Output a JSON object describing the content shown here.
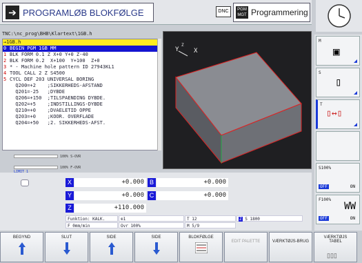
{
  "header": {
    "mode_left": "PROGRAMLØB BLOKFØLGE",
    "dnc": "DNC",
    "pgm_icon": "PGM MGT",
    "mode_right": "Programmering"
  },
  "path": "TNC:\\nc_prog\\BHB\\Klartext\\1GB.h",
  "program": {
    "file_tab": "→1GB.h",
    "lines": [
      {
        "n": "0",
        "t": "BEGIN PGM 1GB MM",
        "sel": true
      },
      {
        "n": "1",
        "t": "BLK FORM 0.1 Z X+0 Y+0 Z-40"
      },
      {
        "n": "2",
        "t": "BLK FORM 0.2  X+100  Y+100  Z+0"
      },
      {
        "n": "3",
        "t": "* - Machine hole pattern ID 27943KL1"
      },
      {
        "n": "4",
        "t": "TOOL CALL 2 Z S4500"
      },
      {
        "n": "5",
        "t": "CYCL DEF 203 UNIVERSAL BORING"
      },
      {
        "n": "",
        "t": "  Q200=+2    ;SIKKERHEDS-AFSTAND"
      },
      {
        "n": "",
        "t": "  Q201=-25   ;DYBDE"
      },
      {
        "n": "",
        "t": "  Q206=+150  ;TILSPAENDING DYBDE."
      },
      {
        "n": "",
        "t": "  Q202=+5    ;INDSTILLINGS-DYBDE"
      },
      {
        "n": "",
        "t": "  Q210=+0    ;DVAELETID OPPE"
      },
      {
        "n": "",
        "t": "  Q203=+0    ;KOOR. OVERFLADE"
      },
      {
        "n": "",
        "t": "  Q204=+50   ;2. SIKKERHEDS-AFST."
      }
    ]
  },
  "overrides": {
    "s": "100% S-OVR",
    "f": "100% F-OVR",
    "limit": "LIMIT 1"
  },
  "axes": [
    {
      "label": "X",
      "value": "+0.000"
    },
    {
      "label": "B",
      "value": "+0.000"
    },
    {
      "label": "Y",
      "value": "+0.000"
    },
    {
      "label": "C",
      "value": "+0.000"
    },
    {
      "label": "Z",
      "value": "+110.000"
    }
  ],
  "info": {
    "funktion": "Funktion: KALK.",
    "tool_num": "1",
    "t": "T 12",
    "z": "Z",
    "s": "S 1800",
    "feed": "F 0mm/min",
    "ovr": "Ovr 100%",
    "m": "M 5/9"
  },
  "side": {
    "m": "M",
    "s": "S",
    "t": "T",
    "s100": "S100%",
    "f100": "F100%",
    "off": "OFF",
    "on": "ON"
  },
  "softkeys": [
    "BEGYND",
    "SLUT",
    "SIDE",
    "SIDE",
    "BLOKFØLGE",
    "EDIT PALETTE",
    "VÆRKTØJS-BRUG",
    "VÆRKTØJS TABEL"
  ],
  "colors": {
    "accent": "#1a1ad8",
    "highlight": "#ffeb20",
    "block_edge": "#d22"
  }
}
